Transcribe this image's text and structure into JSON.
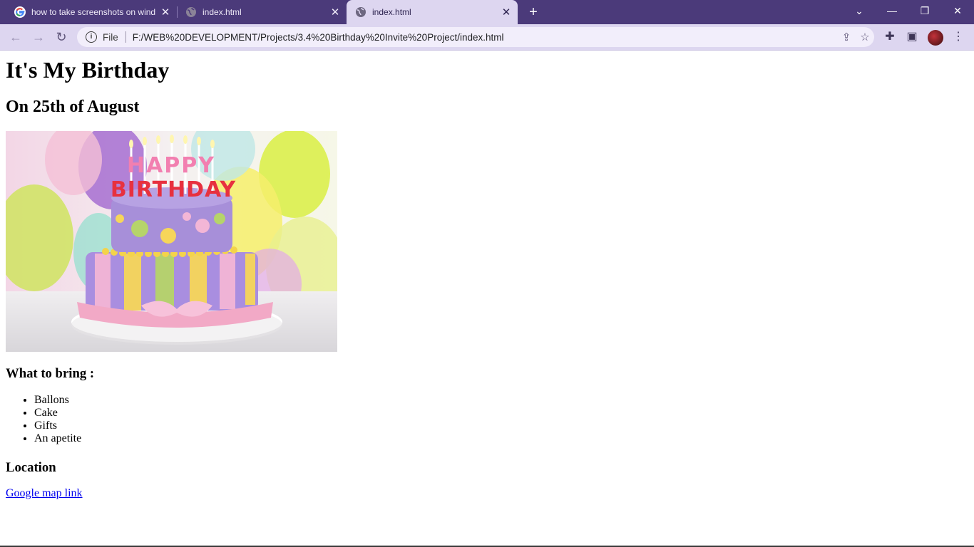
{
  "browser": {
    "tabs": [
      {
        "title": "how to take screenshots on wind",
        "icon": "google-icon",
        "active": false
      },
      {
        "title": "index.html",
        "icon": "globe-icon",
        "active": false
      },
      {
        "title": "index.html",
        "icon": "globe-icon",
        "active": true
      }
    ],
    "address": {
      "scheme_label": "File",
      "url": "F:/WEB%20DEVELOPMENT/Projects/3.4%20Birthday%20Invite%20Project/index.html"
    },
    "accent": "#4b3a7a"
  },
  "page": {
    "heading": "It's My Birthday",
    "subheading": "On 25th of August",
    "cake_text_top": "HAPPY",
    "cake_text_bottom": "BIRTHDAY",
    "bring_heading": "What to bring :",
    "bring_items": [
      "Ballons",
      "Cake",
      "Gifts",
      "An apetite"
    ],
    "location_heading": "Location",
    "map_link": "Google map link"
  }
}
